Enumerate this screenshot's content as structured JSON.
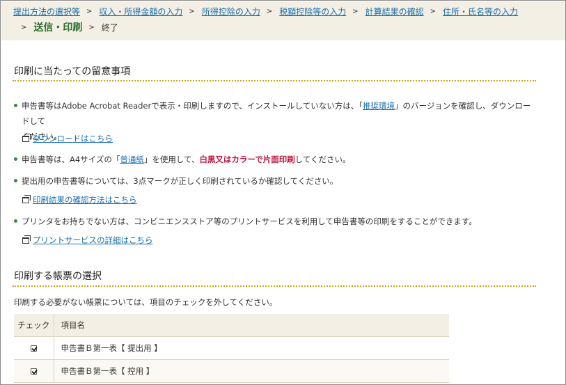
{
  "breadcrumb": {
    "steps": [
      "提出方法の選択等",
      "収入・所得金額の入力",
      "所得控除の入力",
      "税額控除等の入力",
      "計算結果の確認",
      "住所・氏名等の入力"
    ],
    "current": "送信・印刷",
    "next": "終了"
  },
  "notes_section": {
    "title": "印刷に当たっての留意事項",
    "bullet1": {
      "before": "申告書等はAdobe Acrobat Readerで表示・印刷しますので、インストールしていない方は、「",
      "link": "推奨環境",
      "after": "」のバージョンを確認し、ダウンロードして",
      "line2": "ください。"
    },
    "download_link": "ダウンロードはこちら",
    "bullet2": {
      "before": "申告書等は、A4サイズの「",
      "link": "普通紙",
      "middle": "」を使用して、",
      "strong": "白黒又はカラーで片面印刷",
      "after": "してください。"
    },
    "bullet3": "提出用の申告書等については、3点マークが正しく印刷されているか確認してください。",
    "confirm_link": "印刷結果の確認方法はこちら",
    "bullet4": "プリンタをお持ちでない方は、コンビニエンスストア等のプリントサービスを利用して申告書等の印刷をすることができます。",
    "print_service_link": "プリントサービスの詳細はこちら"
  },
  "forms_section": {
    "title": "印刷する帳票の選択",
    "instruction": "印刷する必要がない帳票については、項目のチェックを外してください。",
    "table": {
      "headers": [
        "チェック",
        "項目名"
      ],
      "rows": [
        {
          "name": "申告書Ｂ第一表【 提出用 】",
          "checked": true
        },
        {
          "name": "申告書Ｂ第一表【 控用 】",
          "checked": true
        }
      ]
    }
  },
  "colors": {
    "header_bg": "#f3efe4",
    "link": "#1a6fae",
    "current_step": "#2c6e2f",
    "bullet": "#3a8a3e",
    "rule": "#d4a418",
    "emphasis": "#c0143c"
  }
}
